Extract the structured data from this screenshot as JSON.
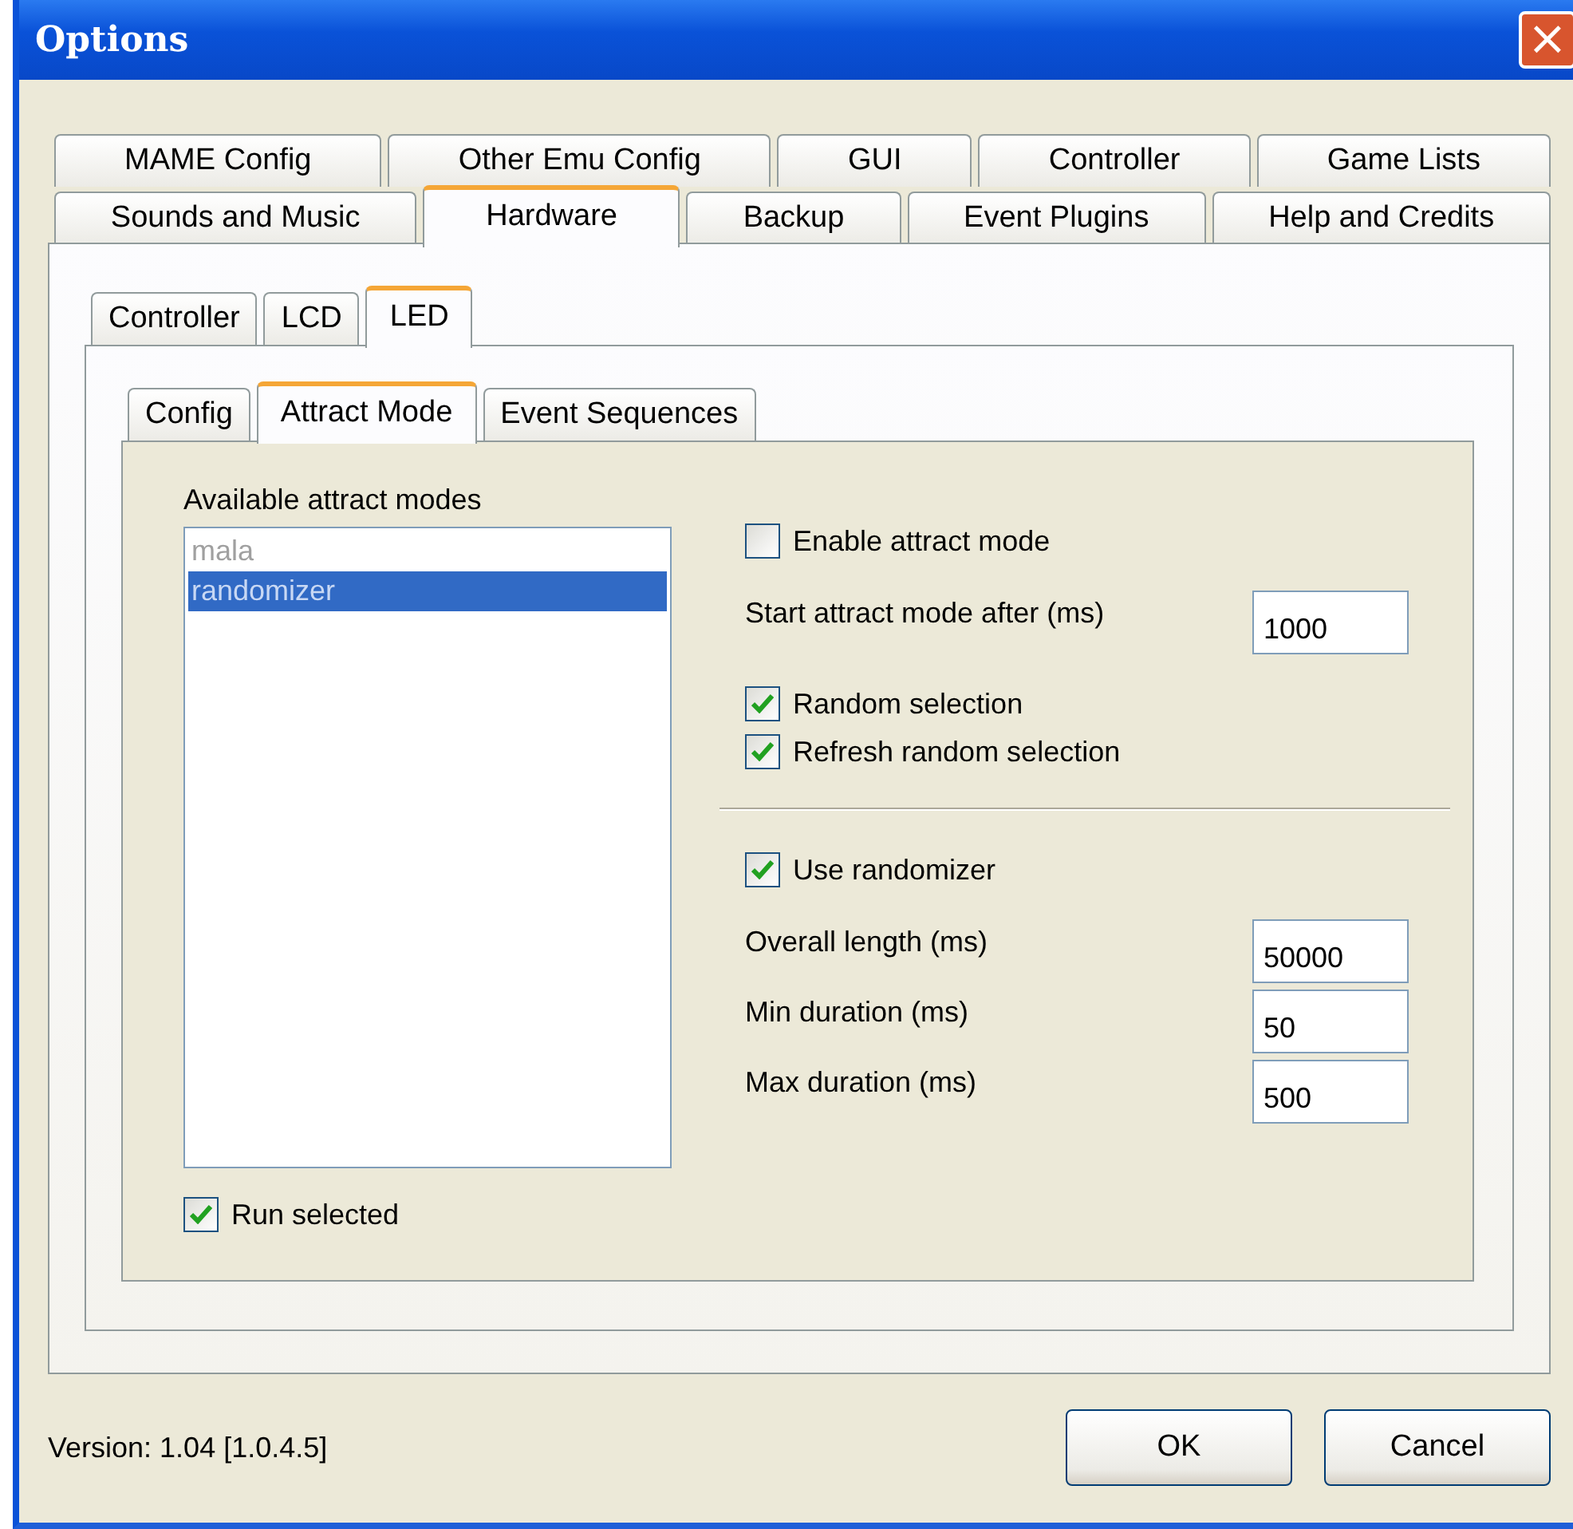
{
  "window": {
    "title": "Options",
    "close": "×"
  },
  "main_tabs": [
    [
      {
        "label": "MAME Config",
        "selected": false
      },
      {
        "label": "Other Emu Config",
        "selected": false
      },
      {
        "label": "GUI",
        "selected": false
      },
      {
        "label": "Controller",
        "selected": false
      },
      {
        "label": "Game Lists",
        "selected": false
      }
    ],
    [
      {
        "label": "Sounds and Music",
        "selected": false
      },
      {
        "label": "Hardware",
        "selected": true
      },
      {
        "label": "Backup",
        "selected": false
      },
      {
        "label": "Event Plugins",
        "selected": false
      },
      {
        "label": "Help and Credits",
        "selected": false
      }
    ]
  ],
  "hardware_tabs": [
    {
      "label": "Controller",
      "selected": false
    },
    {
      "label": "LCD",
      "selected": false
    },
    {
      "label": "LED",
      "selected": true
    }
  ],
  "led_tabs": [
    {
      "label": "Config",
      "selected": false
    },
    {
      "label": "Attract Mode",
      "selected": true
    },
    {
      "label": "Event Sequences",
      "selected": false
    }
  ],
  "attract": {
    "list_label": "Available attract modes",
    "modes": [
      {
        "label": "mala",
        "selected": false,
        "disabled": true
      },
      {
        "label": "randomizer",
        "selected": true,
        "disabled": false
      }
    ],
    "run_selected": {
      "label": "Run selected",
      "checked": true
    },
    "setting_groups": [
      [
        {
          "kind": "checkbox",
          "label": "Enable attract mode",
          "checked": false
        },
        {
          "kind": "field",
          "label": "Start attract mode after (ms)",
          "value": "1000"
        },
        {
          "kind": "checkbox",
          "label": "Random selection",
          "checked": true
        },
        {
          "kind": "checkbox",
          "label": "Refresh random selection",
          "checked": true
        }
      ],
      [
        {
          "kind": "checkbox",
          "label": "Use randomizer",
          "checked": true
        },
        {
          "kind": "field",
          "label": "Overall length (ms)",
          "value": "50000"
        },
        {
          "kind": "field",
          "label": "Min duration (ms)",
          "value": "50"
        },
        {
          "kind": "field",
          "label": "Max duration (ms)",
          "value": "500"
        }
      ]
    ]
  },
  "status": {
    "version": "Version: 1.04 [1.0.4.5]"
  },
  "buttons": [
    "OK",
    "Cancel"
  ]
}
